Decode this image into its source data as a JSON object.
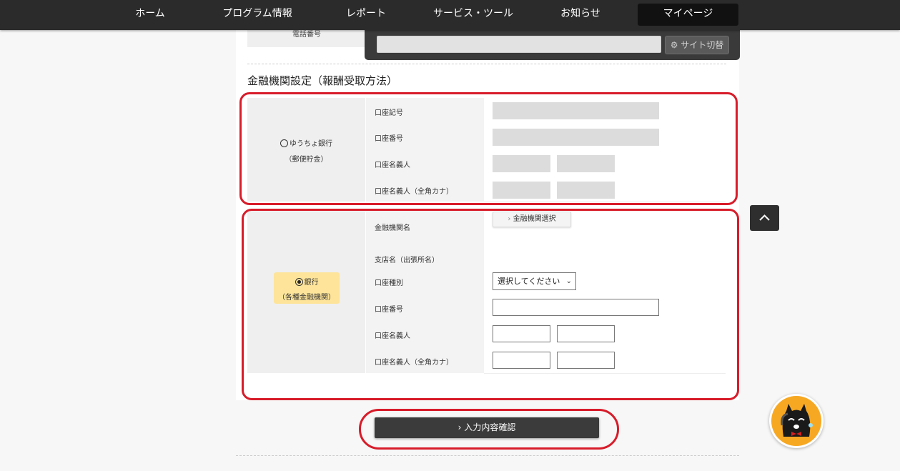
{
  "nav": {
    "items": [
      "ホーム",
      "プログラム情報",
      "レポート",
      "サービス・ツール",
      "お知らせ",
      "マイページ"
    ],
    "active": "マイページ"
  },
  "site_switch": {
    "button_label": "サイト切替",
    "input_value": ""
  },
  "phone": {
    "label": "電話番号"
  },
  "section": {
    "title": "金融機関設定（報酬受取方法）"
  },
  "yucho": {
    "option_label": "ゆうちょ銀行",
    "option_sub": "（郵便貯金）",
    "selected": false,
    "fields": [
      "口座記号",
      "口座番号",
      "口座名義人",
      "口座名義人（全角カナ）"
    ]
  },
  "bank": {
    "option_label": "銀行",
    "option_sub": "（各種金融機関）",
    "selected": true,
    "fields": [
      "金融機関名",
      "支店名（出張所名）",
      "口座種別",
      "口座番号",
      "口座名義人",
      "口座名義人（全角カナ）"
    ],
    "select_institution_label": "金融機関選択",
    "account_type_select": "選択してください"
  },
  "confirm": {
    "label": "入力内容確認"
  },
  "colors": {
    "nav_bg": "#2b2b2b",
    "highlight": "#d81c2a",
    "badge": "#fde49a"
  }
}
